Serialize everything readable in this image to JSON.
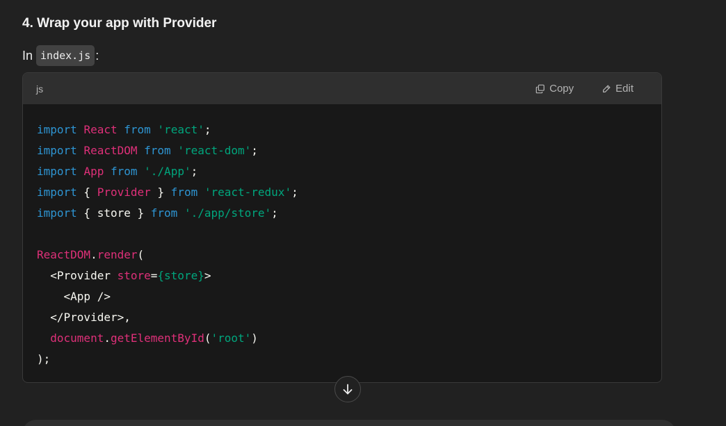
{
  "section": {
    "heading": "4. Wrap your app with Provider",
    "intro_prefix": "In",
    "intro_code": "index.js",
    "intro_suffix": ":"
  },
  "code_block": {
    "language": "js",
    "copy_label": "Copy",
    "edit_label": "Edit",
    "lines": [
      [
        {
          "t": "kw",
          "v": "import"
        },
        {
          "t": "pl",
          "v": " "
        },
        {
          "t": "id",
          "v": "React"
        },
        {
          "t": "pl",
          "v": " "
        },
        {
          "t": "kw",
          "v": "from"
        },
        {
          "t": "pl",
          "v": " "
        },
        {
          "t": "str",
          "v": "'react'"
        },
        {
          "t": "pl",
          "v": ";"
        }
      ],
      [
        {
          "t": "kw",
          "v": "import"
        },
        {
          "t": "pl",
          "v": " "
        },
        {
          "t": "id",
          "v": "ReactDOM"
        },
        {
          "t": "pl",
          "v": " "
        },
        {
          "t": "kw",
          "v": "from"
        },
        {
          "t": "pl",
          "v": " "
        },
        {
          "t": "str",
          "v": "'react-dom'"
        },
        {
          "t": "pl",
          "v": ";"
        }
      ],
      [
        {
          "t": "kw",
          "v": "import"
        },
        {
          "t": "pl",
          "v": " "
        },
        {
          "t": "id",
          "v": "App"
        },
        {
          "t": "pl",
          "v": " "
        },
        {
          "t": "kw",
          "v": "from"
        },
        {
          "t": "pl",
          "v": " "
        },
        {
          "t": "str",
          "v": "'./App'"
        },
        {
          "t": "pl",
          "v": ";"
        }
      ],
      [
        {
          "t": "kw",
          "v": "import"
        },
        {
          "t": "pl",
          "v": " { "
        },
        {
          "t": "id",
          "v": "Provider"
        },
        {
          "t": "pl",
          "v": " } "
        },
        {
          "t": "kw",
          "v": "from"
        },
        {
          "t": "pl",
          "v": " "
        },
        {
          "t": "str",
          "v": "'react-redux'"
        },
        {
          "t": "pl",
          "v": ";"
        }
      ],
      [
        {
          "t": "kw",
          "v": "import"
        },
        {
          "t": "pl",
          "v": " { store } "
        },
        {
          "t": "kw",
          "v": "from"
        },
        {
          "t": "pl",
          "v": " "
        },
        {
          "t": "str",
          "v": "'./app/store'"
        },
        {
          "t": "pl",
          "v": ";"
        }
      ],
      [],
      [
        {
          "t": "id",
          "v": "ReactDOM"
        },
        {
          "t": "pl",
          "v": "."
        },
        {
          "t": "fn",
          "v": "render"
        },
        {
          "t": "pl",
          "v": "("
        }
      ],
      [
        {
          "t": "pl",
          "v": "  <Provider "
        },
        {
          "t": "attr",
          "v": "store"
        },
        {
          "t": "pl",
          "v": "="
        },
        {
          "t": "str",
          "v": "{store}"
        },
        {
          "t": "pl",
          "v": ">"
        }
      ],
      [
        {
          "t": "pl",
          "v": "    <App />"
        }
      ],
      [
        {
          "t": "pl",
          "v": "  </Provider>,"
        }
      ],
      [
        {
          "t": "pl",
          "v": "  "
        },
        {
          "t": "id",
          "v": "document"
        },
        {
          "t": "pl",
          "v": "."
        },
        {
          "t": "fn",
          "v": "getElementById"
        },
        {
          "t": "pl",
          "v": "("
        },
        {
          "t": "str",
          "v": "'root'"
        },
        {
          "t": "pl",
          "v": ")"
        }
      ],
      [
        {
          "t": "pl",
          "v": ");"
        }
      ]
    ]
  },
  "icons": {
    "copy": "copy-icon",
    "edit": "pencil-icon",
    "scroll": "arrow-down-icon"
  },
  "colors": {
    "keyword": "#2e95d3",
    "identifier": "#df3079",
    "string": "#00a67d",
    "background": "#212121",
    "code_background": "#181818",
    "code_header": "#2f2f2f"
  }
}
